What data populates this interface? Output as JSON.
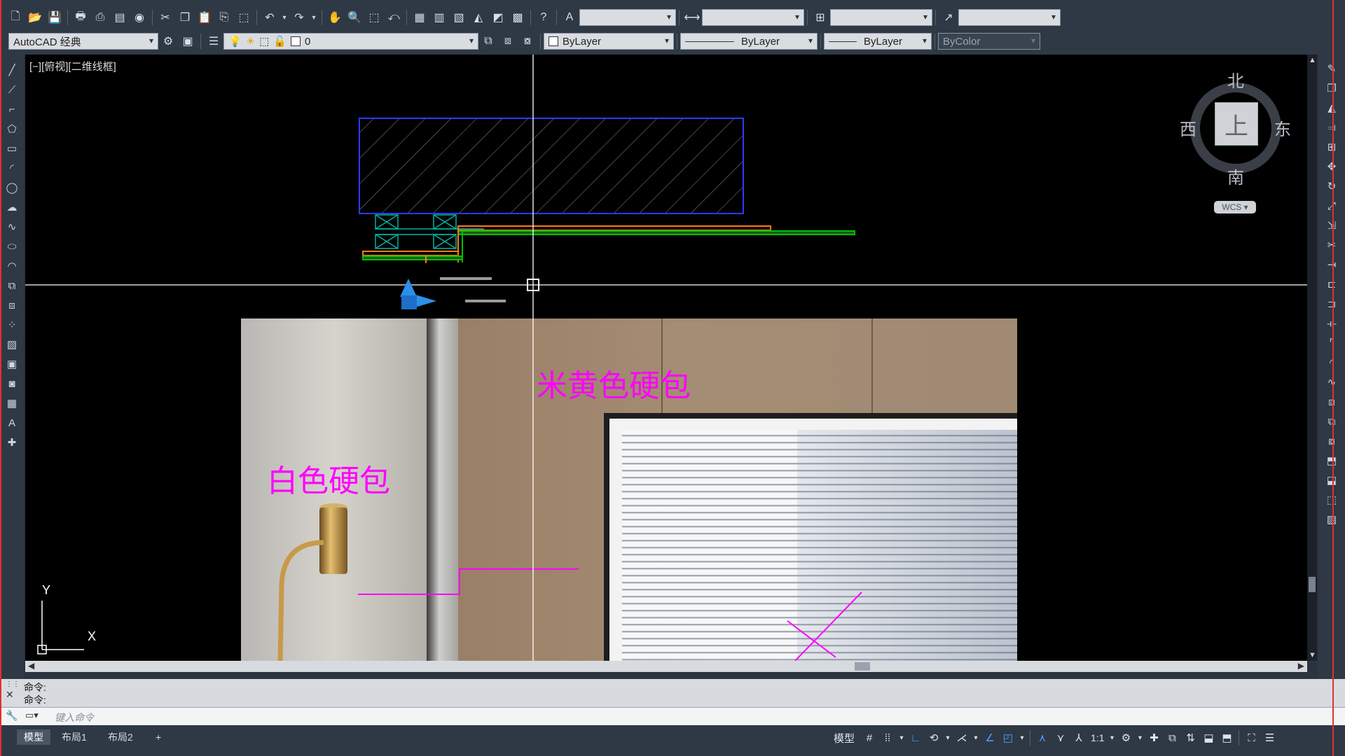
{
  "workspace": {
    "name": "AutoCAD 经典"
  },
  "layer": {
    "name": "0"
  },
  "properties": {
    "color": "ByLayer",
    "linetype": "ByLayer",
    "lineweight": "ByLayer",
    "plotstyle": "ByColor"
  },
  "viewport": {
    "label": "[−][俯视][二维线框]"
  },
  "annotations": {
    "beige": "米黄色硬包",
    "white": "白色硬包"
  },
  "compass": {
    "north": "北",
    "south": "南",
    "east": "东",
    "west": "西",
    "top": "上",
    "wcs": "WCS"
  },
  "ucs": {
    "x": "X",
    "y": "Y"
  },
  "command": {
    "history": [
      "命令:",
      "命令:"
    ],
    "placeholder": "键入命令"
  },
  "layouts": {
    "tabs": [
      "模型",
      "布局1",
      "布局2"
    ],
    "add": "+"
  },
  "status": {
    "model": "模型",
    "scale": "1:1"
  },
  "colors": {
    "magenta": "#ff00ff",
    "cad_blue": "#2a3cff",
    "cad_green": "#00c000",
    "cad_orange": "#ff7a1a",
    "cad_teal": "#00b3a4"
  }
}
